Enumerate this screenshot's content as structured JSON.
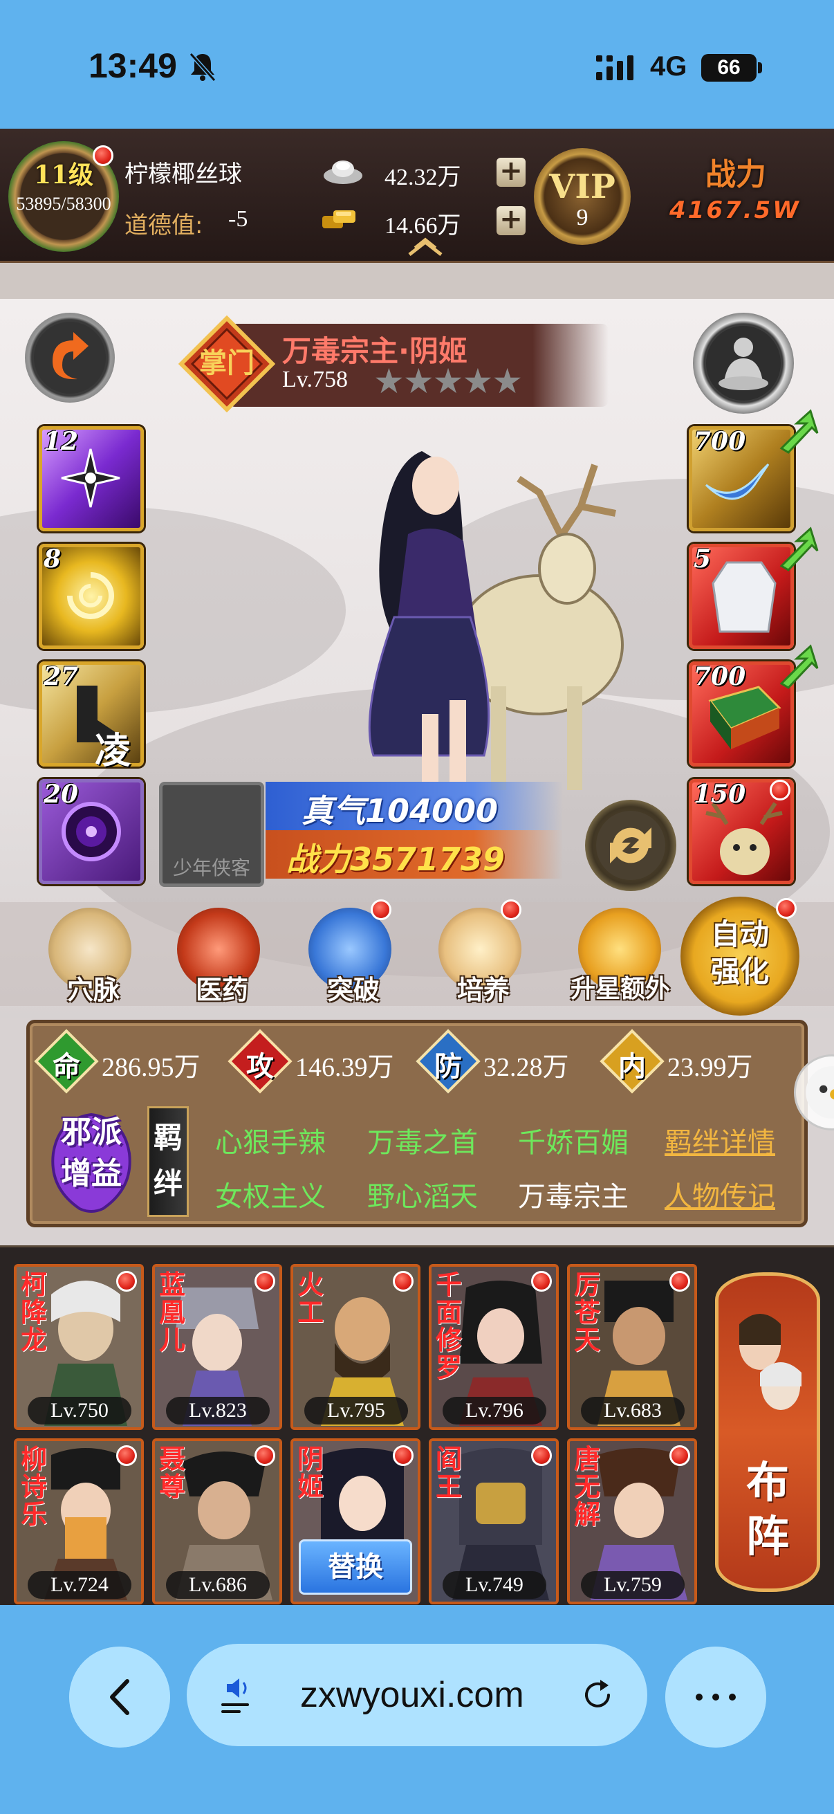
{
  "status_bar": {
    "time": "13:49",
    "network": "4G",
    "battery": "66"
  },
  "player": {
    "level": "11级",
    "exp": "53895/58300",
    "name": "柠檬椰丝球",
    "morality_label": "道德值:",
    "morality_value": "-5",
    "silver": "42.32万",
    "gold": "14.66万",
    "vip_label": "VIP",
    "vip_level": "9",
    "power_label": "战力",
    "power_value": "4167.5W"
  },
  "hero": {
    "name": "万毒宗主·阴姬",
    "level": "Lv.758",
    "stars": "★★★★★",
    "emblem_text": "掌门",
    "qi_text": "真气104000",
    "power_text": "战力3571739",
    "empty_slot_label": "少年侠客"
  },
  "skill_slots": [
    "12",
    "8",
    "27",
    "20"
  ],
  "skill_slot_glyph": "凌",
  "equip_slots": [
    "700",
    "5",
    "700",
    "150"
  ],
  "actions": [
    "穴脉",
    "医药",
    "突破",
    "培养",
    "升星额外"
  ],
  "auto_boost": {
    "line1": "自动",
    "line2": "强化"
  },
  "stats": [
    {
      "char": "命",
      "value": "286.95万",
      "color": "#2f9a2f"
    },
    {
      "char": "攻",
      "value": "146.39万",
      "color": "#c41e1e"
    },
    {
      "char": "防",
      "value": "32.28万",
      "color": "#2a6fc4"
    },
    {
      "char": "内",
      "value": "23.99万",
      "color": "#d8a020"
    }
  ],
  "faction": {
    "line1": "邪派",
    "line2": "增益"
  },
  "bond_tag": {
    "line1": "羁",
    "line2": "绊"
  },
  "bonds": {
    "row1": [
      "心狠手辣",
      "万毒之首",
      "千娇百媚"
    ],
    "row2": [
      "女权主义",
      "野心滔天",
      "万毒宗主"
    ],
    "link1": "羁绊详情",
    "link2": "人物传记"
  },
  "roster": [
    {
      "name": "柯降龙",
      "level": "Lv.750"
    },
    {
      "name": "蓝凰儿",
      "level": "Lv.823"
    },
    {
      "name": "火工",
      "level": "Lv.795"
    },
    {
      "name": "千面修罗",
      "level": "Lv.796"
    },
    {
      "name": "厉苍天",
      "level": "Lv.683"
    },
    {
      "name": "柳诗乐",
      "level": "Lv.724"
    },
    {
      "name": "聂尊",
      "level": "Lv.686"
    },
    {
      "name": "阴姬",
      "level": ""
    },
    {
      "name": "阎王",
      "level": "Lv.749"
    },
    {
      "name": "唐无解",
      "level": "Lv.759"
    }
  ],
  "replace_label": "替换",
  "formation": {
    "line1": "布",
    "line2": "阵"
  },
  "browser": {
    "url": "zxwyouxi.com"
  }
}
